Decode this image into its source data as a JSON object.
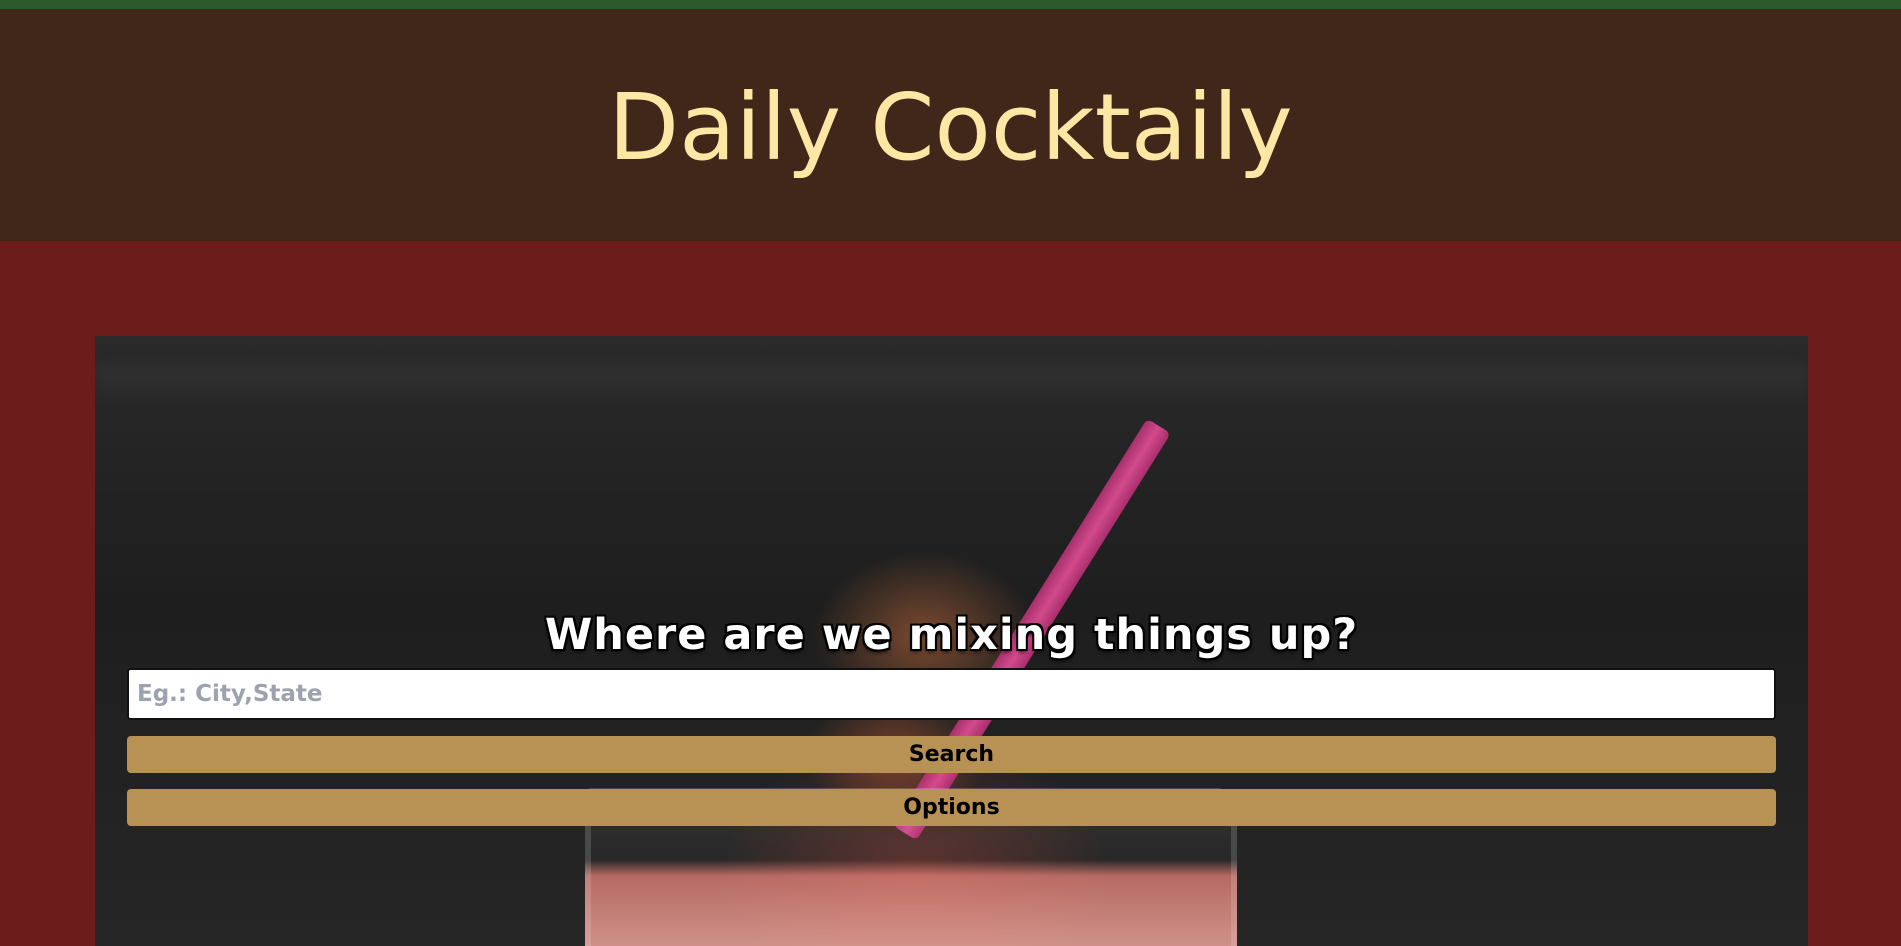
{
  "header": {
    "title": "Daily Cocktaily"
  },
  "colors": {
    "top_bar": "#2c5a2c",
    "header_bg": "#402719",
    "title_color": "#fde7a5",
    "main_bg": "#6d1c1c",
    "button_bg": "#b89255"
  },
  "hero": {
    "image": "cocktail-photo",
    "prompt": "Where are we mixing things up?",
    "search": {
      "placeholder": "Eg.: City,State",
      "value": ""
    },
    "search_button_label": "Search",
    "options_button_label": "Options"
  }
}
